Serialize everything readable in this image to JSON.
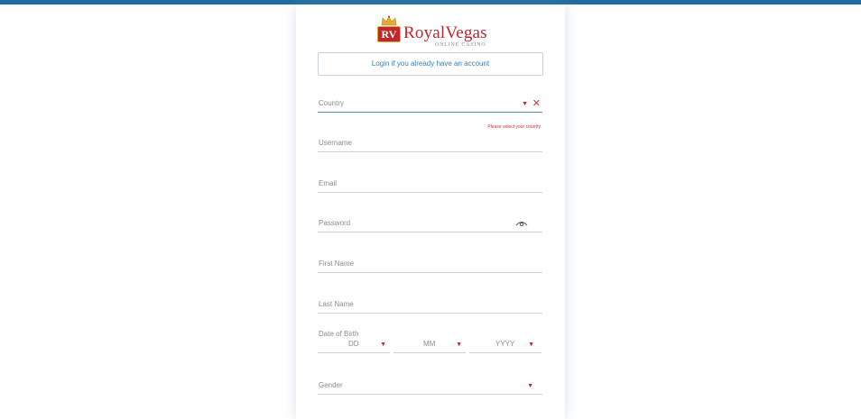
{
  "brand": {
    "logo_badge": "RV",
    "name": "RoyalVegas",
    "tagline": "ONLINE CASINO",
    "colors": {
      "primary_red": "#c0272d",
      "gold": "#e2a93b",
      "top_bar": "#1e6fa0"
    }
  },
  "login_button": {
    "label": "Login if you already have an account"
  },
  "form": {
    "country": {
      "label": "Country",
      "error": "Please select your country"
    },
    "username": {
      "label": "Username"
    },
    "email": {
      "label": "Email"
    },
    "password": {
      "label": "Password",
      "toggle_icon": "eye-icon"
    },
    "first_name": {
      "label": "First Name"
    },
    "last_name": {
      "label": "Last Name"
    },
    "dob": {
      "label": "Date of Birth",
      "day_placeholder": "DD",
      "month_placeholder": "MM",
      "year_placeholder": "YYYY"
    },
    "gender": {
      "label": "Gender"
    },
    "dropdown_icon": "▼",
    "clear_icon": "✕"
  }
}
